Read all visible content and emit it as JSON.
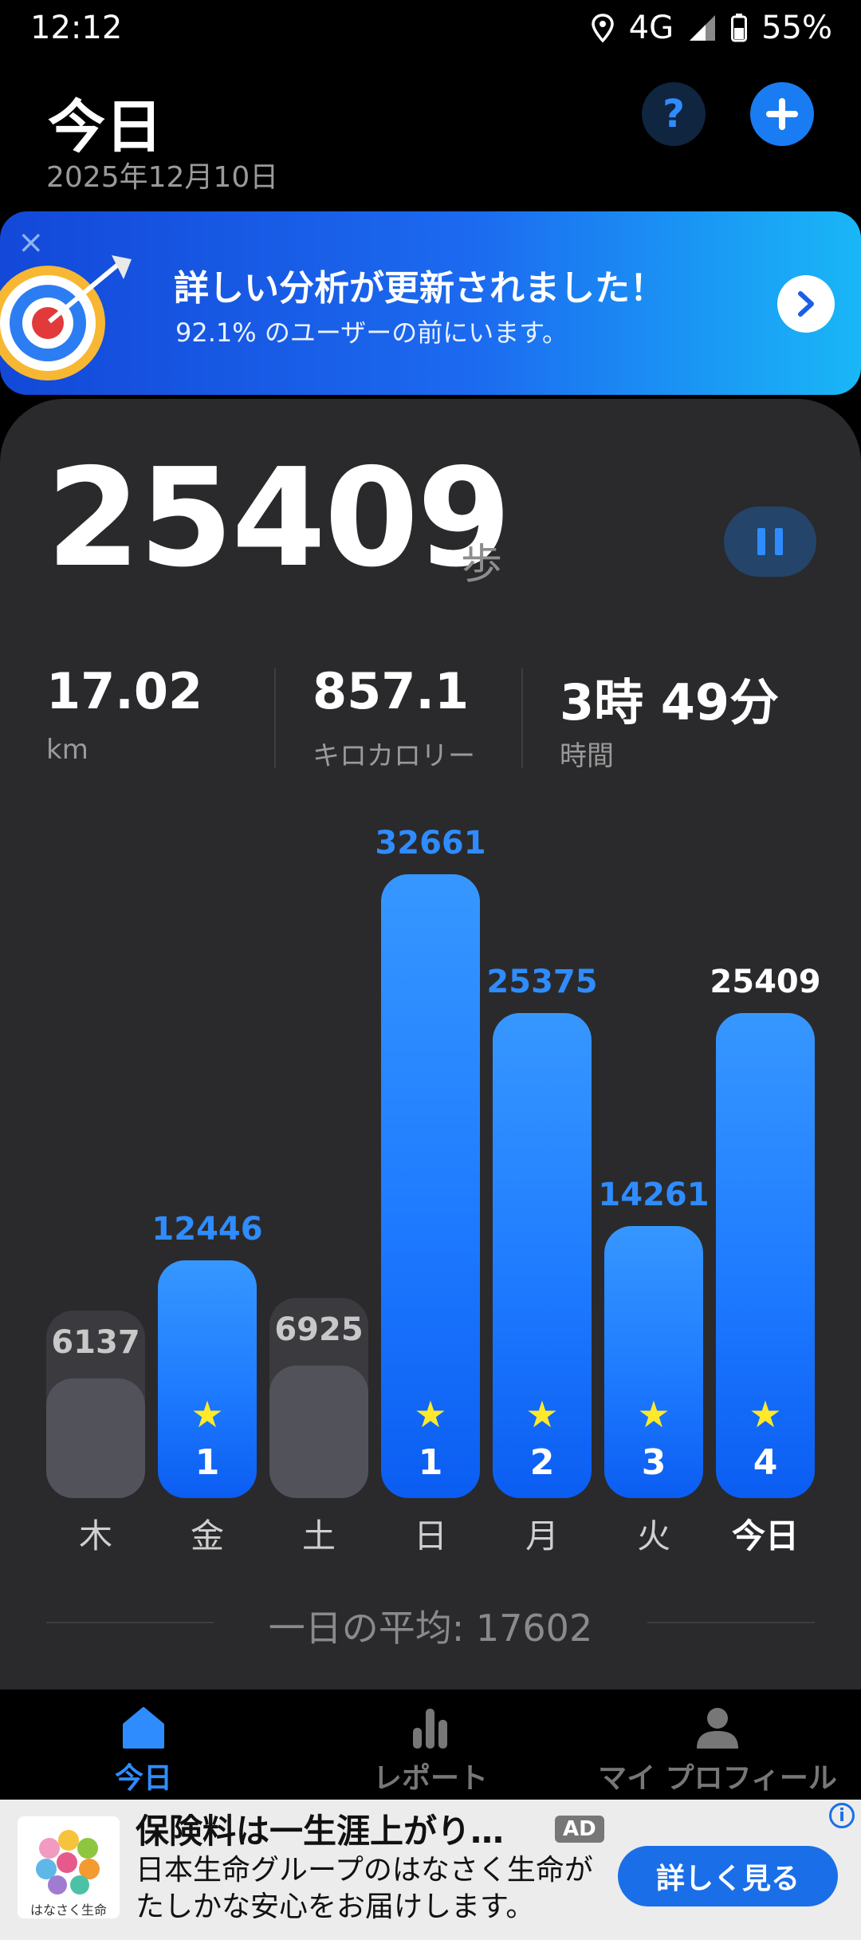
{
  "status_bar": {
    "time": "12:12",
    "network": "4G",
    "battery": "55%"
  },
  "header": {
    "title": "今日",
    "date": "2025年12月10日",
    "help_label": "?",
    "add_label": "+"
  },
  "banner": {
    "title": "詳しい分析が更新されました！",
    "subtitle": "92.1% のユーザーの前にいます。",
    "close_label": "×",
    "arrow_label": "›"
  },
  "summary": {
    "steps": "25409",
    "steps_unit": "歩",
    "stats": [
      {
        "value": "17.02",
        "label": "km"
      },
      {
        "value": "857.1",
        "label": "キロカロリー"
      },
      {
        "value": "3時 49分",
        "label": "時間"
      }
    ]
  },
  "chart_data": {
    "type": "bar",
    "categories": [
      "木",
      "金",
      "土",
      "日",
      "月",
      "火",
      "今日"
    ],
    "values": [
      6137,
      12446,
      6925,
      32661,
      25375,
      14261,
      25409
    ],
    "goal_met": [
      false,
      true,
      false,
      true,
      true,
      true,
      true
    ],
    "star_counts": [
      null,
      "1",
      null,
      "1",
      "2",
      "3",
      "4"
    ],
    "value_labels": [
      "6137",
      "12446",
      "6925",
      "32661",
      "25375",
      "14261",
      "25409"
    ],
    "average_label": "一日の平均: 17602",
    "colors": {
      "goal_met": "#1e7bff",
      "goal_missed": "#52535a",
      "star": "#ffe92a",
      "today_value": "#ffffff",
      "value": "#2f8cff",
      "missed_value": "#c8c8c8"
    }
  },
  "nav": {
    "items": [
      {
        "label": "今日",
        "icon": "home-icon",
        "active": true
      },
      {
        "label": "レポート",
        "icon": "bar-chart-icon",
        "active": false
      },
      {
        "label": "マイ プロフィール",
        "icon": "person-icon",
        "active": false
      }
    ]
  },
  "ad": {
    "title": "保険料は一生涯上がり…",
    "badge": "AD",
    "body": "日本生命グループのはなさく生命がたしかな安心をお届けします。",
    "cta": "詳しく見る",
    "logo_text": "はなさく生命",
    "info_label": "i"
  }
}
